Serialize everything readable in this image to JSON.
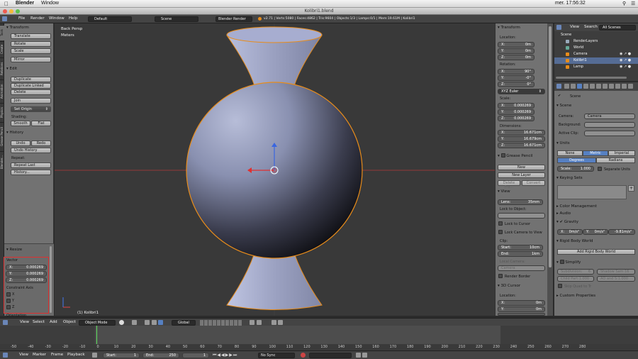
{
  "macbar": {
    "app": "Blender",
    "menu_window": "Window",
    "clock": "mer. 17:56:32"
  },
  "titlebar": {
    "title": "Kolibri1.blend"
  },
  "info_header": {
    "menus": [
      "File",
      "Render",
      "Window",
      "Help"
    ],
    "screen": "Default",
    "scene": "Scene",
    "engine": "Blender Render",
    "stats": "v2.71 | Verts:5080 | Faces:4862 | Tris:9604 | Objects:1/3 | Lamps:0/1 | Mem:19.61M | Kolibri1"
  },
  "left_tabs": [
    "Tools",
    "Create",
    "Relations",
    "Animation",
    "Physics",
    "Grease Pencil",
    "Blender..."
  ],
  "toolshelf": {
    "transform": {
      "header": "Transform",
      "buttons": [
        "Translate",
        "Rotate",
        "Scale",
        "Mirror"
      ]
    },
    "edit": {
      "header": "Edit",
      "buttons": [
        "Duplicate",
        "Duplicate Linked",
        "Delete",
        "Join"
      ],
      "set_origin": "Set Origin",
      "shading_label": "Shading:",
      "smooth": "Smooth",
      "flat": "Flat"
    },
    "history": {
      "header": "History",
      "undo": "Undo",
      "redo": "Redo",
      "undo_history": "Undo History",
      "repeat_label": "Repeat:",
      "repeat_last": "Repeat Last",
      "history_btn": "History..."
    },
    "resize": {
      "header": "Resize",
      "vector_label": "Vector",
      "x_label": "X:",
      "x": "0.000269",
      "y_label": "Y:",
      "y": "0.000269",
      "z_label": "Z:",
      "z": "0.000269",
      "constraint_label": "Constraint Axis",
      "cx": "X",
      "cy": "Y",
      "cz": "Z",
      "orientation": "Orientation"
    }
  },
  "viewport": {
    "view_name": "Back Persp",
    "units": "Meters",
    "object_label": "(1) Kolibri1"
  },
  "npanel": {
    "transform_header": "Transform",
    "location_label": "Location:",
    "loc": [
      [
        "X:",
        "0m"
      ],
      [
        "Y:",
        "0m"
      ],
      [
        "Z:",
        "0m"
      ]
    ],
    "rotation_label": "Rotation:",
    "rot": [
      [
        "X:",
        "90°"
      ],
      [
        "Y:",
        "-0°"
      ],
      [
        "Z:",
        "0°"
      ]
    ],
    "rot_mode": "XYZ Euler",
    "scale_label": "Scale:",
    "scale": [
      [
        "X:",
        "0.000269"
      ],
      [
        "Y:",
        "0.000269"
      ],
      [
        "Z:",
        "0.000269"
      ]
    ],
    "dimensions_label": "Dimensions:",
    "dims": [
      [
        "X:",
        "16.671cm"
      ],
      [
        "Y:",
        "16.679cm"
      ],
      [
        "Z:",
        "16.671cm"
      ]
    ],
    "grease_header": "Grease Pencil",
    "new": "New",
    "new_layer": "New Layer",
    "delete_frame": "Delete Fra...",
    "convert": "Convert",
    "view_header": "View",
    "lens_label": "Lens:",
    "lens": "35mm",
    "lock_object": "Lock to Object:",
    "lock_cursor": "Lock to Cursor",
    "lock_camera": "Lock Camera to View",
    "clip_label": "Clip:",
    "start_label": "Start:",
    "start": "10cm",
    "end_label": "End:",
    "end": "1km",
    "local_camera": "Local Camera:",
    "camera": "Camera",
    "render_border": "Render Border",
    "cursor_header": "3D Cursor",
    "cursor_location": "Location:",
    "cur": [
      [
        "X:",
        "0m"
      ],
      [
        "Y:",
        "0m"
      ],
      [
        "Z:",
        "0m"
      ]
    ]
  },
  "outliner": {
    "menus": [
      "View",
      "Search"
    ],
    "scenes": "All Scenes",
    "items": [
      "Scene",
      "RenderLayers",
      "World",
      "Camera",
      "Kolibri1",
      "Lamp"
    ]
  },
  "properties": {
    "scene_label": "Scene",
    "scene_header": "Scene",
    "camera_label": "Camera:",
    "camera": "Camera",
    "background_label": "Background:",
    "active_clip": "Active Clip:",
    "units_header": "Units",
    "none": "None",
    "metric": "Metric",
    "imperial": "Imperial",
    "degrees": "Degrees",
    "radians": "Radians",
    "scale_label": "Scale:",
    "scale": "1.000",
    "separate_units": "Separate Units",
    "keying_header": "Keying Sets",
    "color_mgmt": "Color Management",
    "audio": "Audio",
    "gravity": "Gravity",
    "gx": "X:",
    "gxv": "0m/s²",
    "gy": "Y:",
    "gyv": "0m/s²",
    "gz": "-9.81m/s²",
    "rigid_header": "Rigid Body World",
    "add_rigid": "Add Rigid Body World",
    "simplify": "Simplify",
    "subdivision": "Subdivision:",
    "subdivision_v": "6",
    "shadow_samples": "Shadow Sam:16",
    "child": "Child Part:1.000",
    "ao": "AO and S:1.000",
    "skip_quad": "Skip Quad to Tr",
    "custom_props": "Custom Properties"
  },
  "viewport_header": {
    "menus": [
      "View",
      "Select",
      "Add",
      "Object"
    ],
    "mode": "Object Mode",
    "orientation": "Global"
  },
  "timeline": {
    "ruler": [
      "-50",
      "-40",
      "-30",
      "-20",
      "-10",
      "0",
      "10",
      "20",
      "30",
      "40",
      "50",
      "60",
      "70",
      "80",
      "90",
      "100",
      "110",
      "120",
      "130",
      "140",
      "150",
      "160",
      "170",
      "180",
      "190",
      "200",
      "210",
      "220",
      "230",
      "240",
      "250",
      "260",
      "270",
      "280"
    ],
    "menus": [
      "View",
      "Marker",
      "Frame",
      "Playback"
    ],
    "start_label": "Start:",
    "start": "1",
    "end_label": "End:",
    "end": "250",
    "current": "1",
    "sync": "No Sync"
  },
  "colors": {
    "selection_outline": "#e88c1a",
    "highlight_box": "#e03030",
    "active_blue": "#5680c2"
  }
}
